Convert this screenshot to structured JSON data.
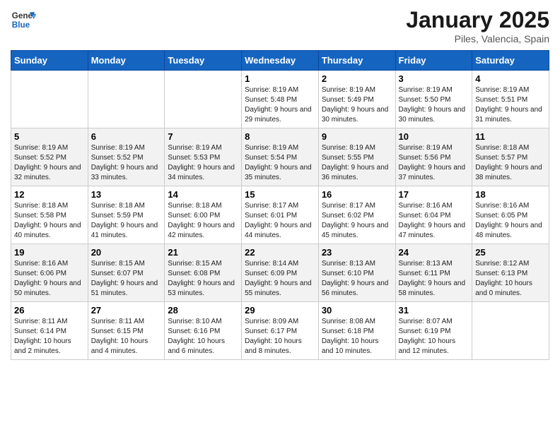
{
  "header": {
    "logo_general": "General",
    "logo_blue": "Blue",
    "title": "January 2025",
    "subtitle": "Piles, Valencia, Spain"
  },
  "days_of_week": [
    "Sunday",
    "Monday",
    "Tuesday",
    "Wednesday",
    "Thursday",
    "Friday",
    "Saturday"
  ],
  "weeks": [
    [
      {
        "day": "",
        "info": ""
      },
      {
        "day": "",
        "info": ""
      },
      {
        "day": "",
        "info": ""
      },
      {
        "day": "1",
        "info": "Sunrise: 8:19 AM\nSunset: 5:48 PM\nDaylight: 9 hours and 29 minutes."
      },
      {
        "day": "2",
        "info": "Sunrise: 8:19 AM\nSunset: 5:49 PM\nDaylight: 9 hours and 30 minutes."
      },
      {
        "day": "3",
        "info": "Sunrise: 8:19 AM\nSunset: 5:50 PM\nDaylight: 9 hours and 30 minutes."
      },
      {
        "day": "4",
        "info": "Sunrise: 8:19 AM\nSunset: 5:51 PM\nDaylight: 9 hours and 31 minutes."
      }
    ],
    [
      {
        "day": "5",
        "info": "Sunrise: 8:19 AM\nSunset: 5:52 PM\nDaylight: 9 hours and 32 minutes."
      },
      {
        "day": "6",
        "info": "Sunrise: 8:19 AM\nSunset: 5:52 PM\nDaylight: 9 hours and 33 minutes."
      },
      {
        "day": "7",
        "info": "Sunrise: 8:19 AM\nSunset: 5:53 PM\nDaylight: 9 hours and 34 minutes."
      },
      {
        "day": "8",
        "info": "Sunrise: 8:19 AM\nSunset: 5:54 PM\nDaylight: 9 hours and 35 minutes."
      },
      {
        "day": "9",
        "info": "Sunrise: 8:19 AM\nSunset: 5:55 PM\nDaylight: 9 hours and 36 minutes."
      },
      {
        "day": "10",
        "info": "Sunrise: 8:19 AM\nSunset: 5:56 PM\nDaylight: 9 hours and 37 minutes."
      },
      {
        "day": "11",
        "info": "Sunrise: 8:18 AM\nSunset: 5:57 PM\nDaylight: 9 hours and 38 minutes."
      }
    ],
    [
      {
        "day": "12",
        "info": "Sunrise: 8:18 AM\nSunset: 5:58 PM\nDaylight: 9 hours and 40 minutes."
      },
      {
        "day": "13",
        "info": "Sunrise: 8:18 AM\nSunset: 5:59 PM\nDaylight: 9 hours and 41 minutes."
      },
      {
        "day": "14",
        "info": "Sunrise: 8:18 AM\nSunset: 6:00 PM\nDaylight: 9 hours and 42 minutes."
      },
      {
        "day": "15",
        "info": "Sunrise: 8:17 AM\nSunset: 6:01 PM\nDaylight: 9 hours and 44 minutes."
      },
      {
        "day": "16",
        "info": "Sunrise: 8:17 AM\nSunset: 6:02 PM\nDaylight: 9 hours and 45 minutes."
      },
      {
        "day": "17",
        "info": "Sunrise: 8:16 AM\nSunset: 6:04 PM\nDaylight: 9 hours and 47 minutes."
      },
      {
        "day": "18",
        "info": "Sunrise: 8:16 AM\nSunset: 6:05 PM\nDaylight: 9 hours and 48 minutes."
      }
    ],
    [
      {
        "day": "19",
        "info": "Sunrise: 8:16 AM\nSunset: 6:06 PM\nDaylight: 9 hours and 50 minutes."
      },
      {
        "day": "20",
        "info": "Sunrise: 8:15 AM\nSunset: 6:07 PM\nDaylight: 9 hours and 51 minutes."
      },
      {
        "day": "21",
        "info": "Sunrise: 8:15 AM\nSunset: 6:08 PM\nDaylight: 9 hours and 53 minutes."
      },
      {
        "day": "22",
        "info": "Sunrise: 8:14 AM\nSunset: 6:09 PM\nDaylight: 9 hours and 55 minutes."
      },
      {
        "day": "23",
        "info": "Sunrise: 8:13 AM\nSunset: 6:10 PM\nDaylight: 9 hours and 56 minutes."
      },
      {
        "day": "24",
        "info": "Sunrise: 8:13 AM\nSunset: 6:11 PM\nDaylight: 9 hours and 58 minutes."
      },
      {
        "day": "25",
        "info": "Sunrise: 8:12 AM\nSunset: 6:13 PM\nDaylight: 10 hours and 0 minutes."
      }
    ],
    [
      {
        "day": "26",
        "info": "Sunrise: 8:11 AM\nSunset: 6:14 PM\nDaylight: 10 hours and 2 minutes."
      },
      {
        "day": "27",
        "info": "Sunrise: 8:11 AM\nSunset: 6:15 PM\nDaylight: 10 hours and 4 minutes."
      },
      {
        "day": "28",
        "info": "Sunrise: 8:10 AM\nSunset: 6:16 PM\nDaylight: 10 hours and 6 minutes."
      },
      {
        "day": "29",
        "info": "Sunrise: 8:09 AM\nSunset: 6:17 PM\nDaylight: 10 hours and 8 minutes."
      },
      {
        "day": "30",
        "info": "Sunrise: 8:08 AM\nSunset: 6:18 PM\nDaylight: 10 hours and 10 minutes."
      },
      {
        "day": "31",
        "info": "Sunrise: 8:07 AM\nSunset: 6:19 PM\nDaylight: 10 hours and 12 minutes."
      },
      {
        "day": "",
        "info": ""
      }
    ]
  ]
}
